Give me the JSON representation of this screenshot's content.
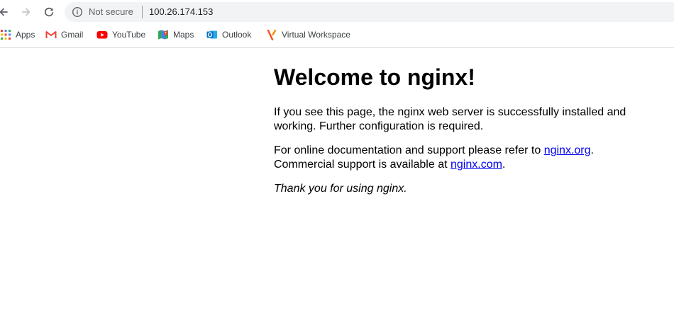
{
  "browser": {
    "security_status": "Not secure",
    "url": "100.26.174.153",
    "icons": {
      "back": "arrow-left-icon",
      "forward": "arrow-right-icon",
      "reload": "reload-icon",
      "info": "info-icon"
    }
  },
  "bookmarks": [
    {
      "label": "Apps",
      "icon": "apps-grid-icon"
    },
    {
      "label": "Gmail",
      "icon": "gmail-icon"
    },
    {
      "label": "YouTube",
      "icon": "youtube-icon"
    },
    {
      "label": "Maps",
      "icon": "maps-icon"
    },
    {
      "label": "Outlook",
      "icon": "outlook-icon"
    },
    {
      "label": "Virtual Workspace",
      "icon": "workspace-icon"
    }
  ],
  "page": {
    "heading": "Welcome to nginx!",
    "para1_line1": "If you see this page, the nginx web server is successfully installed and",
    "para1_line2": "working. Further configuration is required.",
    "para2_line1_prefix": "For online documentation and support please refer to ",
    "link_org": "nginx.org",
    "para2_line1_suffix": ".",
    "para2_line2_prefix": "Commercial support is available at ",
    "link_com": "nginx.com",
    "para2_line2_suffix": ".",
    "thanks": "Thank you for using nginx."
  },
  "colors": {
    "link": "#0000ee",
    "omnibox_bg": "#f1f3f4",
    "youtube_red": "#ff0000",
    "gmail_red": "#ea4335",
    "outlook_blue": "#0072c6"
  }
}
